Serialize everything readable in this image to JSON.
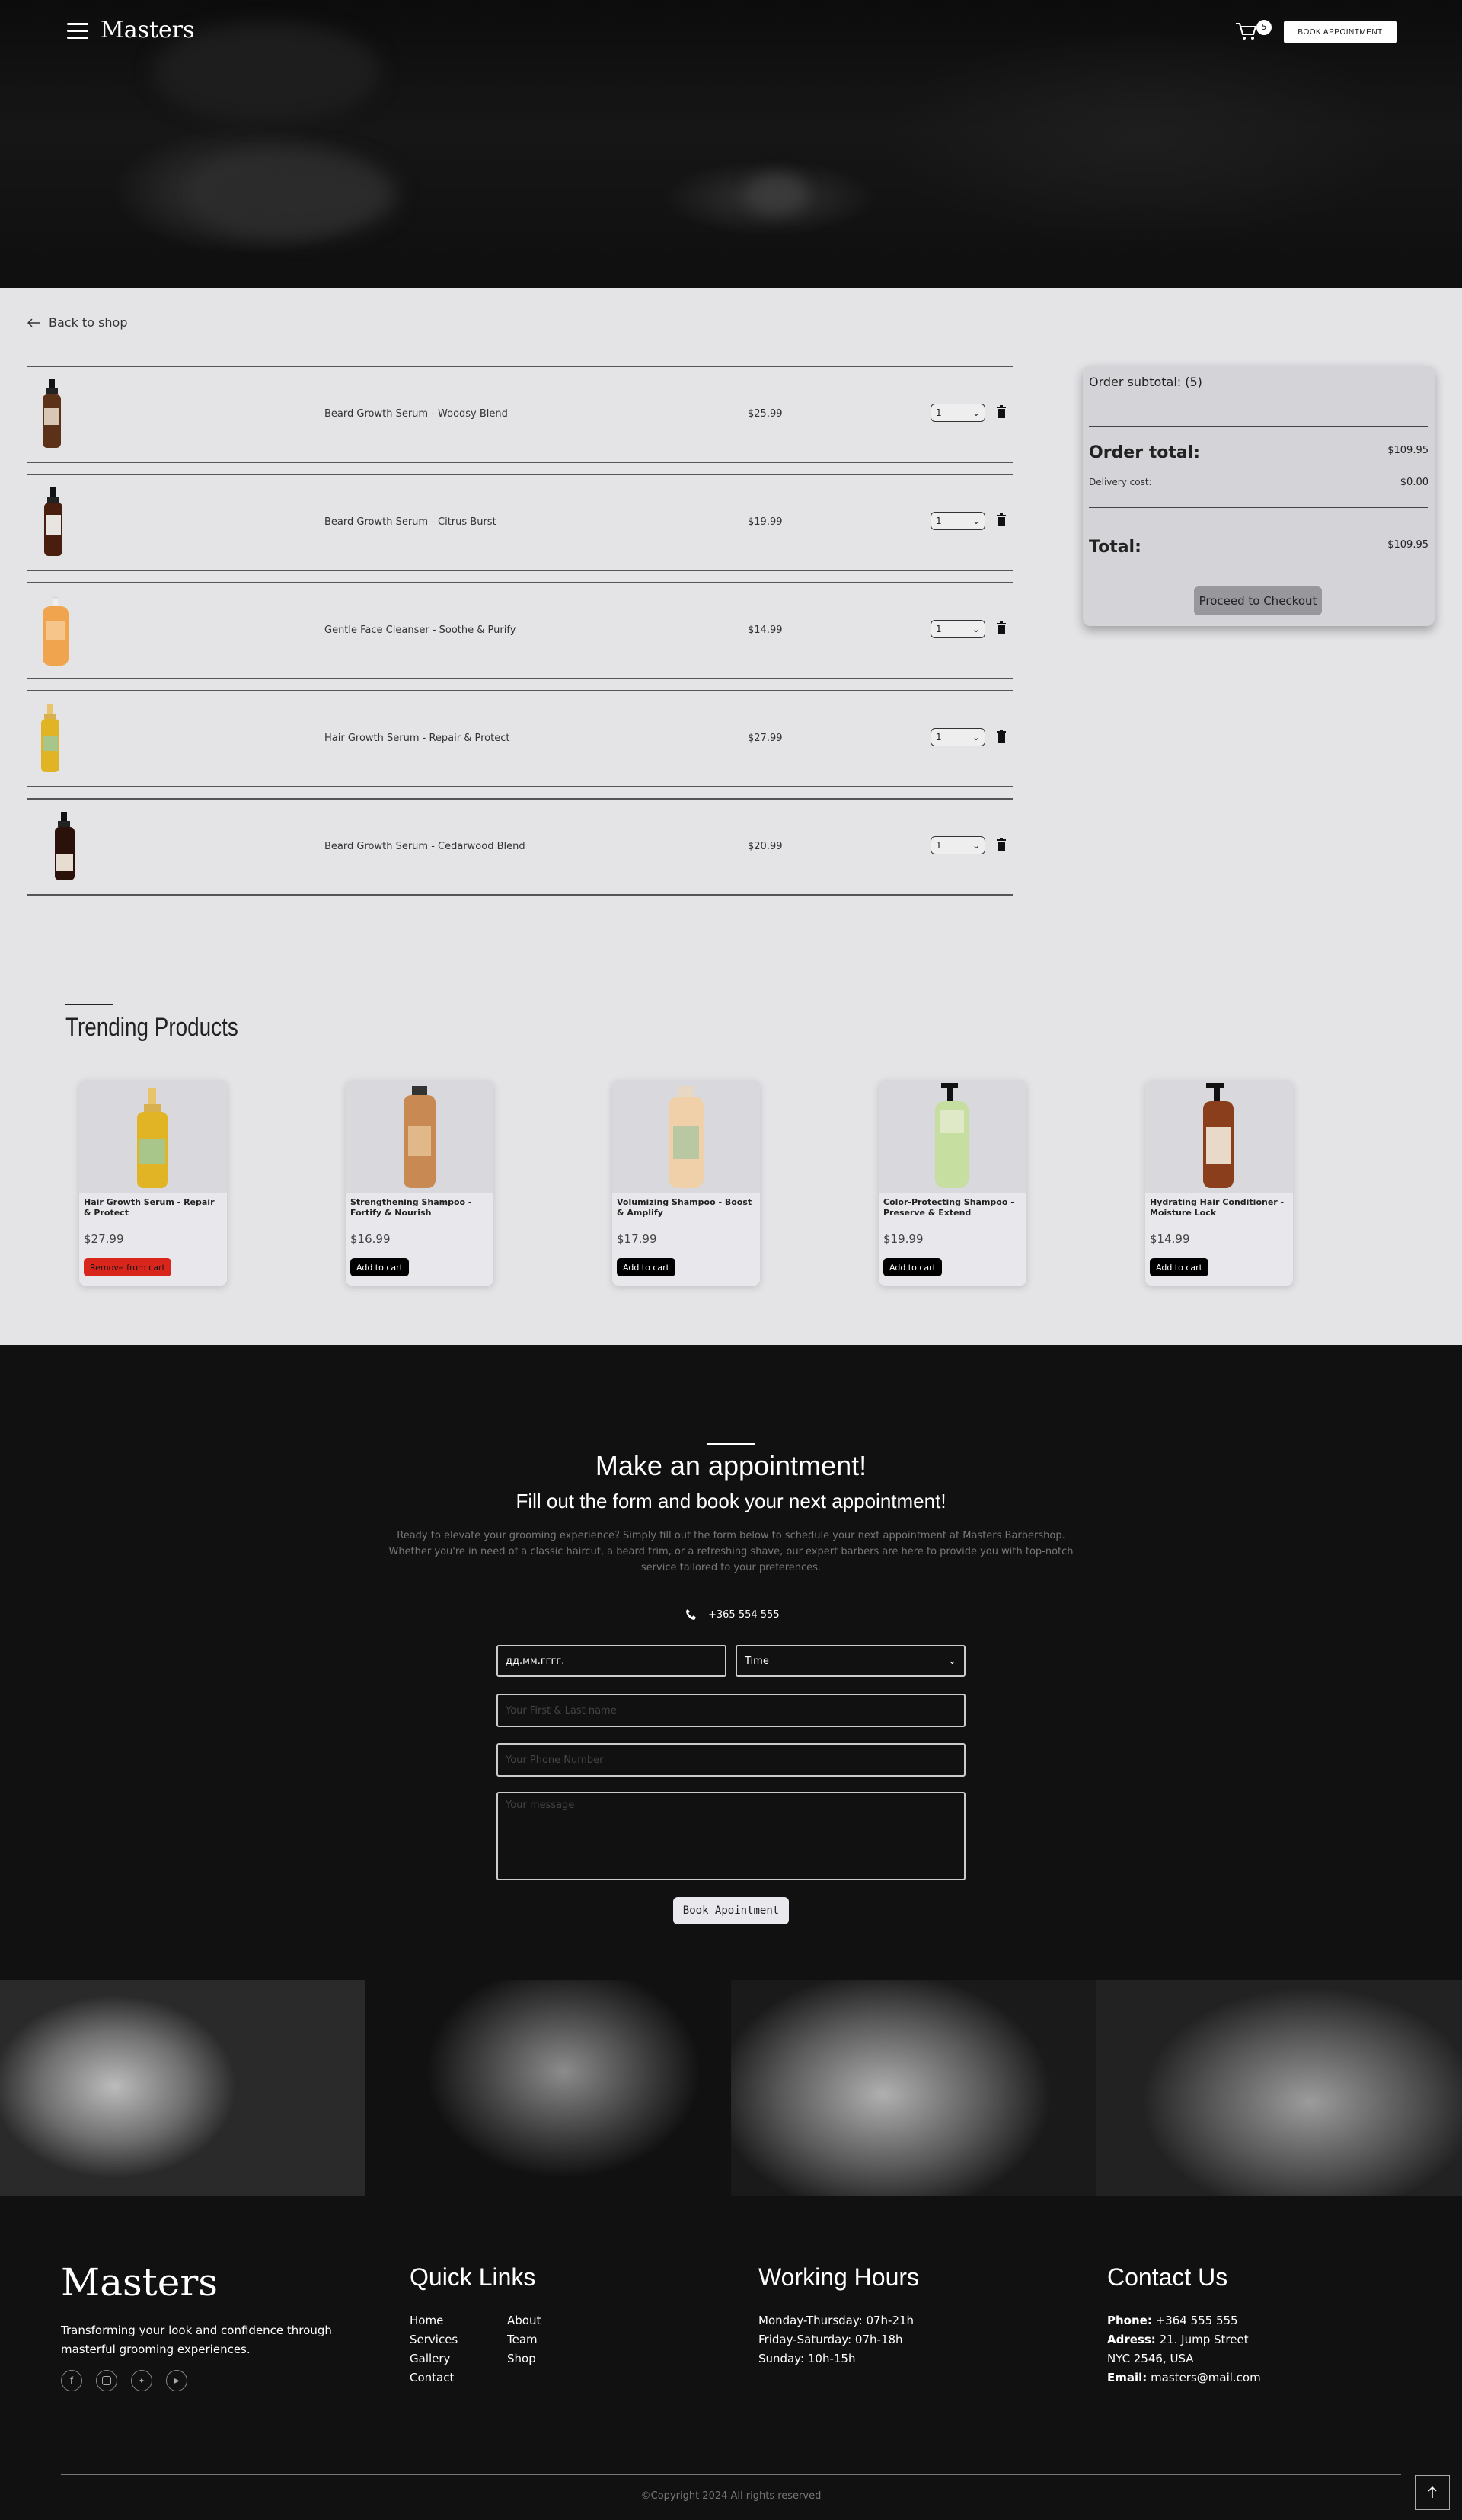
{
  "nav": {
    "brand": "Masters",
    "cart_count": "5",
    "book_label": "BOOK APPOINTMENT"
  },
  "cart": {
    "back_label": "Back to shop",
    "items": [
      {
        "name": "Beard Growth Serum - Woodsy Blend",
        "price": "$25.99",
        "qty": "1"
      },
      {
        "name": "Beard Growth Serum - Citrus Burst",
        "price": "$19.99",
        "qty": "1"
      },
      {
        "name": "Gentle Face Cleanser - Soothe & Purify",
        "price": "$14.99",
        "qty": "1"
      },
      {
        "name": "Hair Growth Serum - Repair & Protect",
        "price": "$27.99",
        "qty": "1"
      },
      {
        "name": "Beard Growth Serum - Cedarwood Blend",
        "price": "$20.99",
        "qty": "1"
      }
    ]
  },
  "summary": {
    "subtotal_label": "Order subtotal: (5)",
    "order_total_label": "Order total:",
    "order_total_value": "$109.95",
    "delivery_label": "Delivery cost:",
    "delivery_value": "$0.00",
    "total_label": "Total:",
    "total_value": "$109.95",
    "checkout_label": "Proceed to Checkout"
  },
  "trending": {
    "title": "Trending Products",
    "products": [
      {
        "title": "Hair Growth Serum - Repair & Protect",
        "price": "$27.99",
        "button": "Remove from cart"
      },
      {
        "title": "Strengthening Shampoo - Fortify & Nourish",
        "price": "$16.99",
        "button": "Add to cart"
      },
      {
        "title": "Volumizing Shampoo - Boost & Amplify",
        "price": "$17.99",
        "button": "Add to cart"
      },
      {
        "title": "Color-Protecting Shampoo - Preserve & Extend",
        "price": "$19.99",
        "button": "Add to cart"
      },
      {
        "title": "Hydrating Hair Conditioner - Moisture Lock",
        "price": "$14.99",
        "button": "Add to cart"
      }
    ]
  },
  "appointment": {
    "title": "Make an appointment!",
    "subtitle": "Fill out the form and book your next appointment!",
    "description": "Ready to elevate your grooming experience? Simply fill out the form below to schedule your next appointment at Masters Barbershop. Whether you're in need of a classic haircut, a beard trim, or a refreshing shave, our expert barbers are here to provide you with top-notch service tailored to your preferences.",
    "phone": "+365 554 555",
    "date_placeholder": "дд.мм.гггг.",
    "time_label": "Time",
    "name_placeholder": "Your First & Last name",
    "phone_placeholder": "Your Phone Number",
    "message_placeholder": "Your message",
    "button": "Book Apointment"
  },
  "footer": {
    "brand": "Masters",
    "tagline": "Transforming your look and confidence through masterful grooming experiences.",
    "quick_links_title": "Quick Links",
    "links_col1": [
      "Home",
      "Services",
      "Gallery",
      "Contact"
    ],
    "links_col2": [
      "About",
      "Team",
      "Shop"
    ],
    "hours_title": "Working Hours",
    "hours": [
      "Monday-Thursday: 07h-21h",
      "Friday-Saturday: 07h-18h",
      "Sunday: 10h-15h"
    ],
    "contact_title": "Contact Us",
    "contact": {
      "phone_label": "Phone:",
      "phone": "+364 555 555",
      "address_label": "Adress:",
      "address1": "21. Jump Street",
      "address2": "NYC 2546, USA",
      "email_label": "Email:",
      "email": "masters@mail.com"
    },
    "copyright": "©Copyright 2024 All rights reserved"
  },
  "icons": [
    "menu-icon",
    "cart-icon",
    "arrow-left-icon",
    "trash-icon",
    "chevron-down-icon",
    "phone-icon",
    "facebook-icon",
    "instagram-icon",
    "twitter-icon",
    "youtube-icon",
    "arrow-up-icon"
  ],
  "colors": {
    "dark": "#111111",
    "remove_button": "#d9261c",
    "page_bg": "#e4e4e7"
  }
}
